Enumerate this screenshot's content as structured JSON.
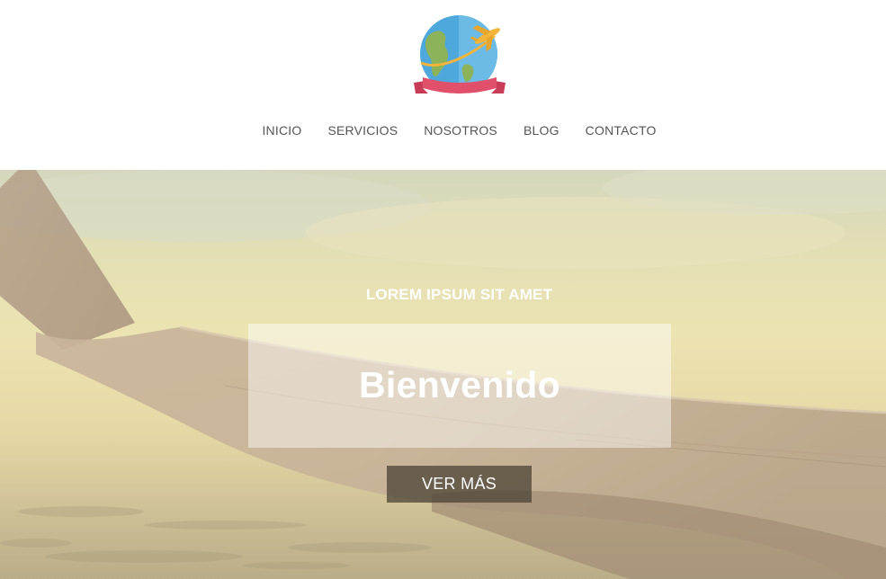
{
  "header": {
    "logo_icon": "globe-airplane-logo",
    "nav": [
      {
        "label": "INICIO"
      },
      {
        "label": "SERVICIOS"
      },
      {
        "label": "NOSOTROS"
      },
      {
        "label": "BLOG"
      },
      {
        "label": "CONTACTO"
      }
    ]
  },
  "hero": {
    "background_image": "airplane-wing-over-clouds",
    "subtitle": "LOREM IPSUM SIT AMET",
    "title": "Bienvenido",
    "button_label": "VER MÁS"
  },
  "colors": {
    "nav_text": "#555555",
    "globe_ocean": "#4aa3d8",
    "globe_land": "#8fb35a",
    "airplane": "#f2b43a",
    "ribbon": "#e0506a"
  }
}
